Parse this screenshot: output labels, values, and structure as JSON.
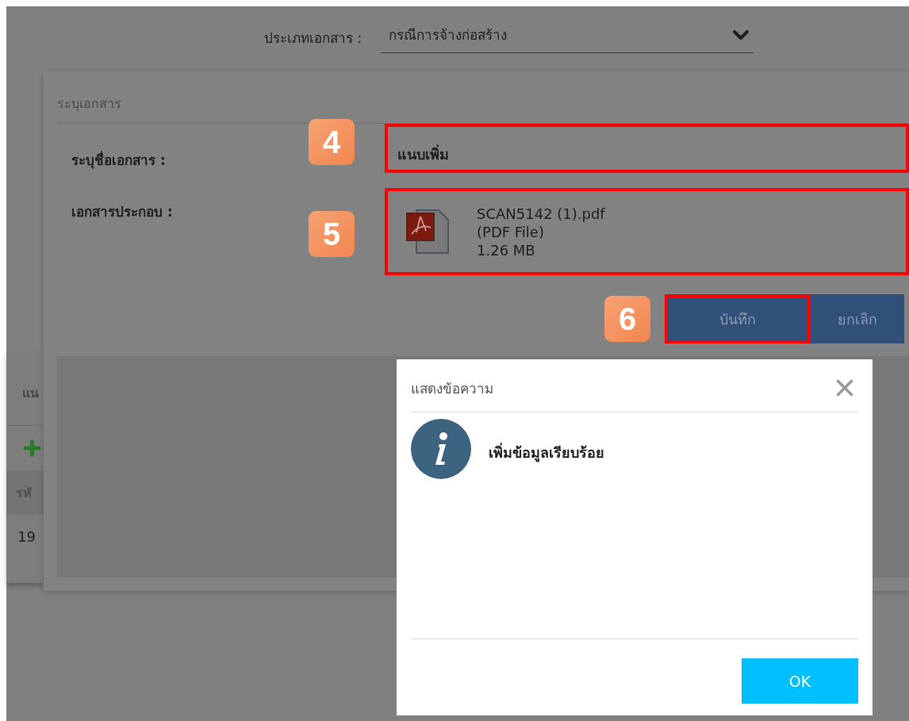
{
  "page": {
    "document_type": {
      "label": "ประเภทเอกสาร :",
      "value": "กรณีการจ้างก่อสร้าง"
    },
    "side_panel": {
      "title": "แน",
      "column_header": "รหั",
      "rows": [
        "19"
      ]
    }
  },
  "form_dialog": {
    "title": "ระบุเอกสาร",
    "fields": [
      {
        "kind": "text",
        "label": "ระบุชื่อเอกสาร :",
        "step": "4",
        "highlighted": true,
        "value": "แนบเพิ่ม"
      },
      {
        "kind": "file",
        "label": "เอกสารประกอบ :",
        "step": "5",
        "highlighted": true,
        "file_name": "SCAN5142 (1).pdf",
        "file_type": "(PDF File)",
        "file_size": "1.26 MB"
      }
    ],
    "buttons": [
      {
        "label": "บันทึก",
        "step": "6",
        "highlighted": true
      },
      {
        "label": "ยกเลิก",
        "highlighted": false
      }
    ]
  },
  "message_dialog": {
    "title": "แสดงข้อความ",
    "message": "เพิ่มข้อมูลเรียบร้อย",
    "button": "OK"
  }
}
